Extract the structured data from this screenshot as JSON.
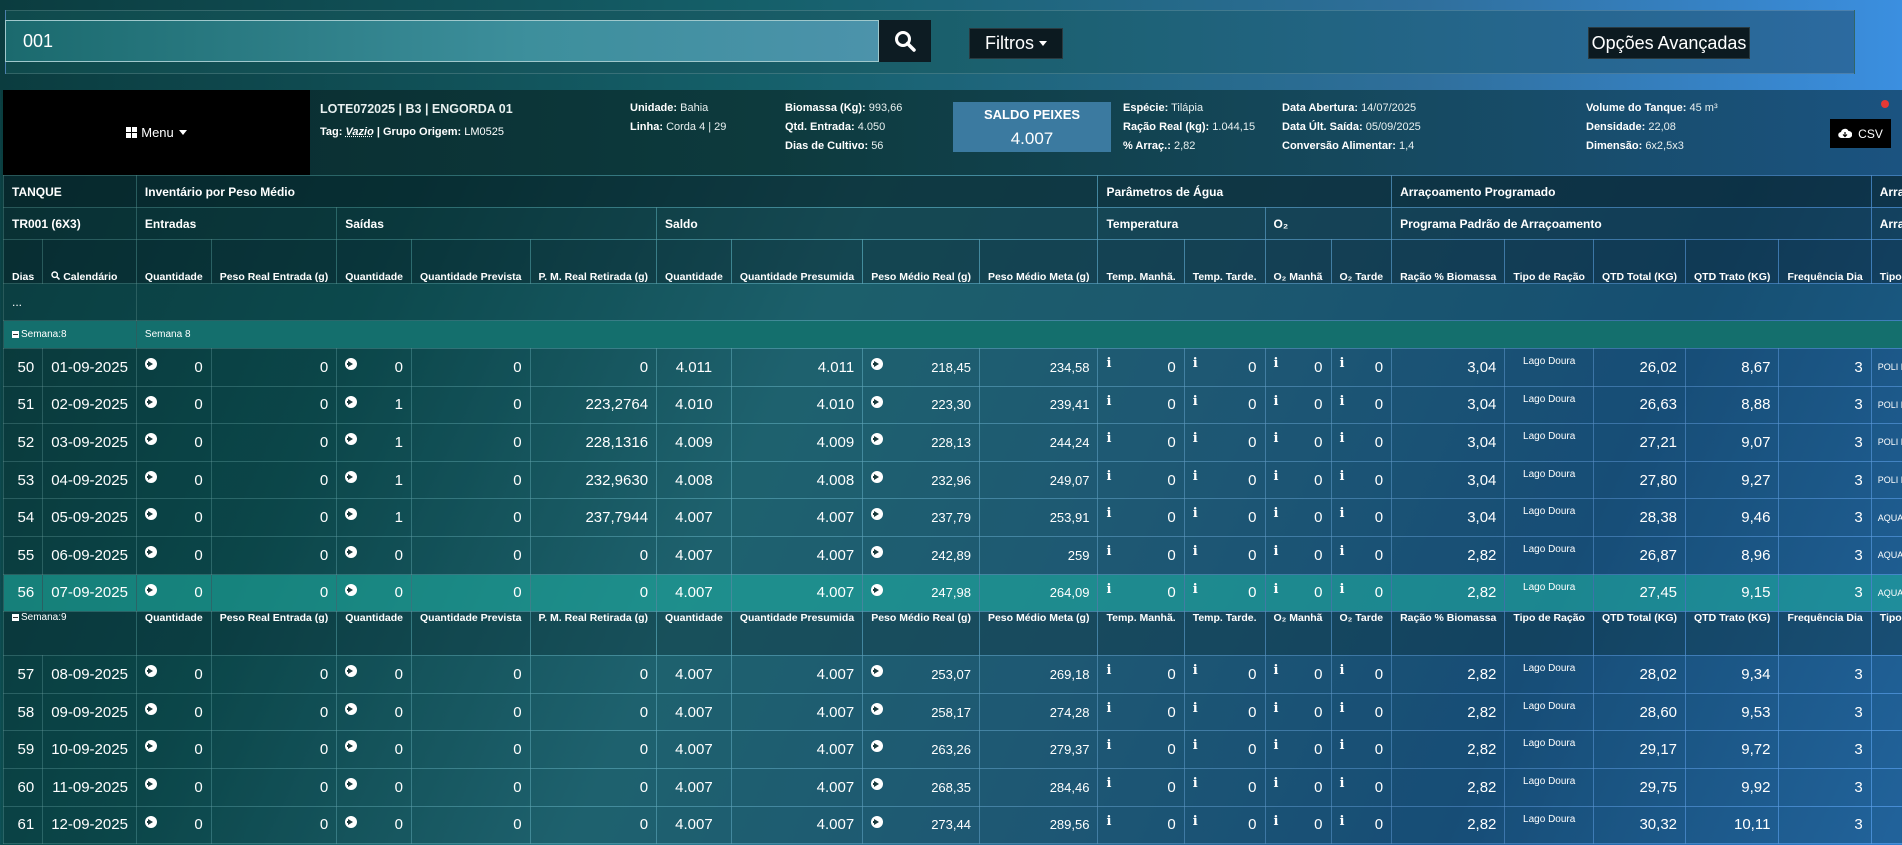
{
  "search": {
    "value": "001"
  },
  "toolbar": {
    "filters_label": "Filtros",
    "advanced_label": "Opções Avançadas"
  },
  "menu_label": "Menu",
  "lot": {
    "title": "LOTE072025 | B3 | ENGORDA 01",
    "tag_label": "Tag:",
    "tag_value": "Vazio",
    "group_label": "| Grupo Origem:",
    "group_value": "LM0525",
    "unidade_label": "Unidade:",
    "unidade": "Bahia",
    "linha_label": "Linha:",
    "linha": "Corda 4 | 29",
    "biomassa_label": "Biomassa (Kg):",
    "biomassa": "993,66",
    "qtd_entrada_label": "Qtd. Entrada:",
    "qtd_entrada": "4.050",
    "dias_label": "Dias de Cultivo:",
    "dias": "56",
    "saldo_label": "SALDO PEIXES",
    "saldo": "4.007",
    "especie_label": "Espécie:",
    "especie": "Tilápia",
    "racao_label": "Ração Real (kg):",
    "racao": "1.044,15",
    "arrac_label": "% Arraç.:",
    "arrac": "2,82",
    "abertura_label": "Data Abertura:",
    "abertura": "14/07/2025",
    "ult_saida_label": "Data Últ. Saída:",
    "ult_saida": "05/09/2025",
    "conversao_label": "Conversão Alimentar:",
    "conversao": "1,4",
    "volume_label": "Volume do Tanque:",
    "volume": "45 m³",
    "densidade_label": "Densidade:",
    "densidade": "22,08",
    "dimensao_label": "Dimensão:",
    "dimensao": "6x2,5x3",
    "csv_label": "CSV"
  },
  "headers": {
    "tanque": "TANQUE",
    "inventario": "Inventário por Peso Médio",
    "parametros": "Parâmetros de Água",
    "arracoamento": "Arraçoamento Programado",
    "arracoamento_cut": "Arraçoa",
    "tank_id": "TR001 (6X3)",
    "entradas": "Entradas",
    "saidas": "Saídas",
    "saldo": "Saldo",
    "temperatura": "Temperatura",
    "o2": "O₂",
    "programa": "Programa Padrão de Arraçoamento",
    "arracoamento_cut2": "Arraçoa",
    "dias": "Dias",
    "calendario": "Calendário",
    "cols": [
      "Quantidade",
      "Peso Real Entrada (g)",
      "Quantidade",
      "Quantidade Prevista",
      "P. M. Real Retirada (g)",
      "Quantidade",
      "Quantidade Presumida",
      "Peso Médio Real (g)",
      "Peso Médio Meta (g)",
      "Temp. Manhã.",
      "Temp. Tarde.",
      "O₂ Manhã",
      "O₂ Tarde",
      "Ração % Biomassa",
      "Tipo de Ração",
      "QTD Total (KG)",
      "QTD Trato (KG)",
      "Frequência Dia",
      "Tipo de Ração"
    ]
  },
  "ellipsis": "...",
  "weeks": {
    "w8": "Semana:8",
    "w8_label": "Semana 8",
    "w9": "Semana:9"
  },
  "rows_w8": [
    {
      "dia": "50",
      "data": "01-09-2025",
      "q_ent": "0",
      "peso_ent": "0",
      "q_sai": "0",
      "q_prev": "0",
      "pm_ret": "0",
      "saldo": "4.011",
      "presumida": "4.011",
      "pm_real": "218,45",
      "pm_meta": "234,58",
      "tm": "0",
      "tt": "0",
      "o2m": "0",
      "o2t": "0",
      "racao_pct": "3,04",
      "tipo": "Lago Doura",
      "qtd_total": "26,02",
      "qtd_trato": "8,67",
      "freq": "3",
      "tipo2": "POLI F"
    },
    {
      "dia": "51",
      "data": "02-09-2025",
      "q_ent": "0",
      "peso_ent": "0",
      "q_sai": "1",
      "q_prev": "0",
      "pm_ret": "223,2764",
      "saldo": "4.010",
      "presumida": "4.010",
      "pm_real": "223,30",
      "pm_meta": "239,41",
      "tm": "0",
      "tt": "0",
      "o2m": "0",
      "o2t": "0",
      "racao_pct": "3,04",
      "tipo": "Lago Doura",
      "qtd_total": "26,63",
      "qtd_trato": "8,88",
      "freq": "3",
      "tipo2": "POLI F"
    },
    {
      "dia": "52",
      "data": "03-09-2025",
      "q_ent": "0",
      "peso_ent": "0",
      "q_sai": "1",
      "q_prev": "0",
      "pm_ret": "228,1316",
      "saldo": "4.009",
      "presumida": "4.009",
      "pm_real": "228,13",
      "pm_meta": "244,24",
      "tm": "0",
      "tt": "0",
      "o2m": "0",
      "o2t": "0",
      "racao_pct": "3,04",
      "tipo": "Lago Doura",
      "qtd_total": "27,21",
      "qtd_trato": "9,07",
      "freq": "3",
      "tipo2": "POLI F"
    },
    {
      "dia": "53",
      "data": "04-09-2025",
      "q_ent": "0",
      "peso_ent": "0",
      "q_sai": "1",
      "q_prev": "0",
      "pm_ret": "232,9630",
      "saldo": "4.008",
      "presumida": "4.008",
      "pm_real": "232,96",
      "pm_meta": "249,07",
      "tm": "0",
      "tt": "0",
      "o2m": "0",
      "o2t": "0",
      "racao_pct": "3,04",
      "tipo": "Lago Doura",
      "qtd_total": "27,80",
      "qtd_trato": "9,27",
      "freq": "3",
      "tipo2": "POLI F"
    },
    {
      "dia": "54",
      "data": "05-09-2025",
      "q_ent": "0",
      "peso_ent": "0",
      "q_sai": "1",
      "q_prev": "0",
      "pm_ret": "237,7944",
      "saldo": "4.007",
      "presumida": "4.007",
      "pm_real": "237,79",
      "pm_meta": "253,91",
      "tm": "0",
      "tt": "0",
      "o2m": "0",
      "o2t": "0",
      "racao_pct": "3,04",
      "tipo": "Lago Doura",
      "qtd_total": "28,38",
      "qtd_trato": "9,46",
      "freq": "3",
      "tipo2": "AQUAV"
    },
    {
      "dia": "55",
      "data": "06-09-2025",
      "q_ent": "0",
      "peso_ent": "0",
      "q_sai": "0",
      "q_prev": "0",
      "pm_ret": "0",
      "saldo": "4.007",
      "presumida": "4.007",
      "pm_real": "242,89",
      "pm_meta": "259",
      "tm": "0",
      "tt": "0",
      "o2m": "0",
      "o2t": "0",
      "racao_pct": "2,82",
      "tipo": "Lago Doura",
      "qtd_total": "26,87",
      "qtd_trato": "8,96",
      "freq": "3",
      "tipo2": "AQUAV"
    },
    {
      "dia": "56",
      "data": "07-09-2025",
      "q_ent": "0",
      "peso_ent": "0",
      "q_sai": "0",
      "q_prev": "0",
      "pm_ret": "0",
      "saldo": "4.007",
      "presumida": "4.007",
      "pm_real": "247,98",
      "pm_meta": "264,09",
      "tm": "0",
      "tt": "0",
      "o2m": "0",
      "o2t": "0",
      "racao_pct": "2,82",
      "tipo": "Lago Doura",
      "qtd_total": "27,45",
      "qtd_trato": "9,15",
      "freq": "3",
      "tipo2": "AQUAV"
    }
  ],
  "rows_w9": [
    {
      "dia": "57",
      "data": "08-09-2025",
      "q_ent": "0",
      "peso_ent": "0",
      "q_sai": "0",
      "q_prev": "0",
      "pm_ret": "0",
      "saldo": "4.007",
      "presumida": "4.007",
      "pm_real": "253,07",
      "pm_meta": "269,18",
      "tm": "0",
      "tt": "0",
      "o2m": "0",
      "o2t": "0",
      "racao_pct": "2,82",
      "tipo": "Lago Doura",
      "qtd_total": "28,02",
      "qtd_trato": "9,34",
      "freq": "3",
      "tipo2": ""
    },
    {
      "dia": "58",
      "data": "09-09-2025",
      "q_ent": "0",
      "peso_ent": "0",
      "q_sai": "0",
      "q_prev": "0",
      "pm_ret": "0",
      "saldo": "4.007",
      "presumida": "4.007",
      "pm_real": "258,17",
      "pm_meta": "274,28",
      "tm": "0",
      "tt": "0",
      "o2m": "0",
      "o2t": "0",
      "racao_pct": "2,82",
      "tipo": "Lago Doura",
      "qtd_total": "28,60",
      "qtd_trato": "9,53",
      "freq": "3",
      "tipo2": ""
    },
    {
      "dia": "59",
      "data": "10-09-2025",
      "q_ent": "0",
      "peso_ent": "0",
      "q_sai": "0",
      "q_prev": "0",
      "pm_ret": "0",
      "saldo": "4.007",
      "presumida": "4.007",
      "pm_real": "263,26",
      "pm_meta": "279,37",
      "tm": "0",
      "tt": "0",
      "o2m": "0",
      "o2t": "0",
      "racao_pct": "2,82",
      "tipo": "Lago Doura",
      "qtd_total": "29,17",
      "qtd_trato": "9,72",
      "freq": "3",
      "tipo2": ""
    },
    {
      "dia": "60",
      "data": "11-09-2025",
      "q_ent": "0",
      "peso_ent": "0",
      "q_sai": "0",
      "q_prev": "0",
      "pm_ret": "0",
      "saldo": "4.007",
      "presumida": "4.007",
      "pm_real": "268,35",
      "pm_meta": "284,46",
      "tm": "0",
      "tt": "0",
      "o2m": "0",
      "o2t": "0",
      "racao_pct": "2,82",
      "tipo": "Lago Doura",
      "qtd_total": "29,75",
      "qtd_trato": "9,92",
      "freq": "3",
      "tipo2": ""
    },
    {
      "dia": "61",
      "data": "12-09-2025",
      "q_ent": "0",
      "peso_ent": "0",
      "q_sai": "0",
      "q_prev": "0",
      "pm_ret": "0",
      "saldo": "4.007",
      "presumida": "4.007",
      "pm_real": "273,44",
      "pm_meta": "289,56",
      "tm": "0",
      "tt": "0",
      "o2m": "0",
      "o2t": "0",
      "racao_pct": "2,82",
      "tipo": "Lago Doura",
      "qtd_total": "30,32",
      "qtd_trato": "10,11",
      "freq": "3",
      "tipo2": ""
    }
  ],
  "selected_day": "56"
}
